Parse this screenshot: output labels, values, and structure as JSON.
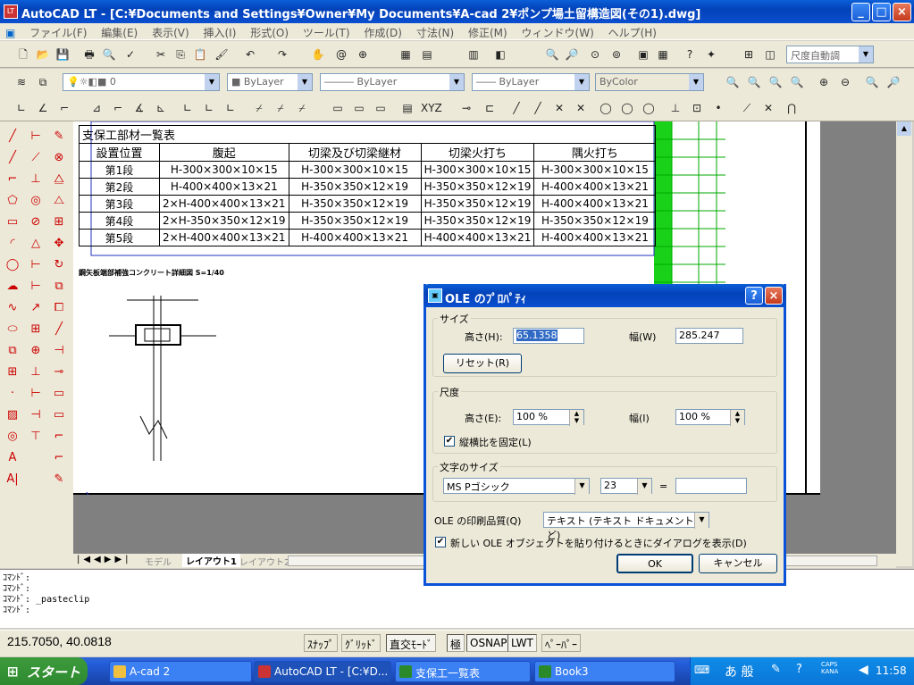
{
  "window": {
    "title": "AutoCAD LT - [C:¥Documents and Settings¥Owner¥My Documents¥A-cad 2¥ポンプ場土留構造図(その1).dwg]"
  },
  "menu": [
    "ファイル(F)",
    "編集(E)",
    "表示(V)",
    "挿入(I)",
    "形式(O)",
    "ツール(T)",
    "作成(D)",
    "寸法(N)",
    "修正(M)",
    "ウィンドウ(W)",
    "ヘルプ(H)"
  ],
  "toolbar": {
    "dimstyle": "尺度自動調",
    "layer": "0",
    "color": "ByLayer",
    "linetype": "ByLayer",
    "lineweight": "ByLayer",
    "plotstyle": "ByColor"
  },
  "drawing": {
    "table_title": "支保工部材一覧表",
    "headers": [
      "設置位置",
      "腹起",
      "切梁及び切梁継材",
      "切梁火打ち",
      "隅火打ち"
    ],
    "rows": [
      [
        "第1段",
        "H-300×300×10×15",
        "H-300×300×10×15",
        "H-300×300×10×15",
        "H-300×300×10×15"
      ],
      [
        "第2段",
        "H-400×400×13×21",
        "H-350×350×12×19",
        "H-350×350×12×19",
        "H-400×400×13×21"
      ],
      [
        "第3段",
        "2×H-400×400×13×21",
        "H-350×350×12×19",
        "H-350×350×12×19",
        "H-400×400×13×21"
      ],
      [
        "第4段",
        "2×H-350×350×12×19",
        "H-350×350×12×19",
        "H-350×350×12×19",
        "H-350×350×12×19"
      ],
      [
        "第5段",
        "2×H-400×400×13×21",
        "H-400×400×13×21",
        "H-400×400×13×21",
        "H-400×400×13×21"
      ]
    ],
    "detail_caption": "鋼矢板端部補強コンクリート詳細図 S=1/40"
  },
  "layout_tabs": [
    "モデル",
    "レイアウト1",
    "レイアウト2"
  ],
  "command_lines": [
    "ｺﾏﾝﾄﾞ:",
    "ｺﾏﾝﾄﾞ:",
    "ｺﾏﾝﾄﾞ: _pasteclip",
    "ｺﾏﾝﾄﾞ:"
  ],
  "status": {
    "coords": "215.7050, 40.0818",
    "buttons": [
      "ｽﾅｯﾌﾟ",
      "ｸﾞﾘｯﾄﾞ",
      "直交ﾓｰﾄﾞ",
      "極",
      "OSNAP",
      "LWT",
      "ﾍﾟｰﾊﾟｰ"
    ]
  },
  "dialog": {
    "title": "OLE のﾌﾟﾛﾊﾟﾃｨ",
    "size_group": "サイズ",
    "height_label": "高さ(H):",
    "height_value": "65.1358",
    "width_label": "幅(W)",
    "width_value": "285.247",
    "reset": "リセット(R)",
    "scale_group": "尺度",
    "scale_height_label": "高さ(E):",
    "scale_height_value": "100 %",
    "scale_width_label": "幅(I)",
    "scale_width_value": "100 %",
    "lock_aspect": "縦横比を固定(L)",
    "text_size_group": "文字のサイズ",
    "font_value": "MS Pゴシック",
    "point_value": "23",
    "equals": "=",
    "quality_label": "OLE の印刷品質(Q)",
    "quality_value": "テキスト (テキスト ドキュメントなど)",
    "show_dialog": "新しい OLE オブジェクトを貼り付けるときにダイアログを表示(D)",
    "ok": "OK",
    "cancel": "キャンセル"
  },
  "taskbar": {
    "start": "スタート",
    "tasks": [
      "A-cad 2",
      "AutoCAD LT - [C:¥D...",
      "支保工一覧表",
      "Book3"
    ],
    "clock": "11:58",
    "ime": "あ 般"
  }
}
